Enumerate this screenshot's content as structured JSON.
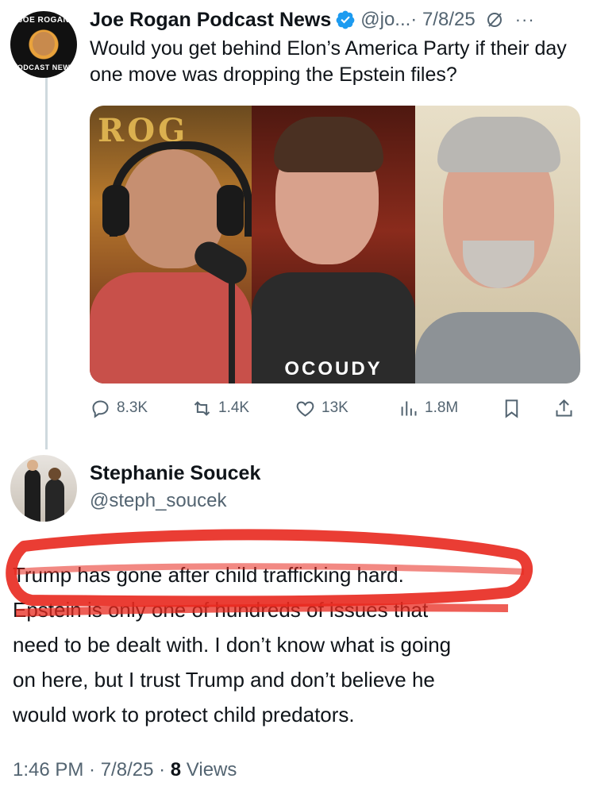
{
  "parent_tweet": {
    "avatar_text_top": "JOE ROGAN",
    "avatar_text_bottom": "PODCAST NEWS",
    "author_name": "Joe Rogan Podcast News",
    "handle": "@jo...",
    "date": "· 7/8/25",
    "text": "Would you get behind Elon’s America Party if their day one move was dropping the Epstein files?",
    "media": {
      "panel_1_sign": "ROG",
      "panel_2_shirt_text": "OCOUDY"
    },
    "actions": {
      "replies": "8.3K",
      "reposts": "1.4K",
      "likes": "13K",
      "views": "1.8M"
    },
    "icons": [
      "verified-badge-icon",
      "grok-icon",
      "more-icon",
      "reply-icon",
      "repost-icon",
      "like-icon",
      "views-icon",
      "bookmark-icon",
      "share-icon"
    ],
    "colors": {
      "verified": "#1d9bf0",
      "secondary_text": "#536471",
      "thread_line": "#cfd9de"
    }
  },
  "reply": {
    "author_name": "Stephanie Soucek",
    "handle": "@steph_soucek",
    "lines": [
      "Trump has gone after child trafficking hard.",
      "Epstein is only one of hundreds of issues that",
      "need to be dealt with. I don’t know what is going",
      "on here, but I trust Trump and don’t believe he",
      "would work to protect child predators."
    ],
    "time": "1:46 PM · 7/8/25 ·",
    "views_count": "8",
    "views_label": "Views",
    "annotation_color": "#e8281e"
  }
}
